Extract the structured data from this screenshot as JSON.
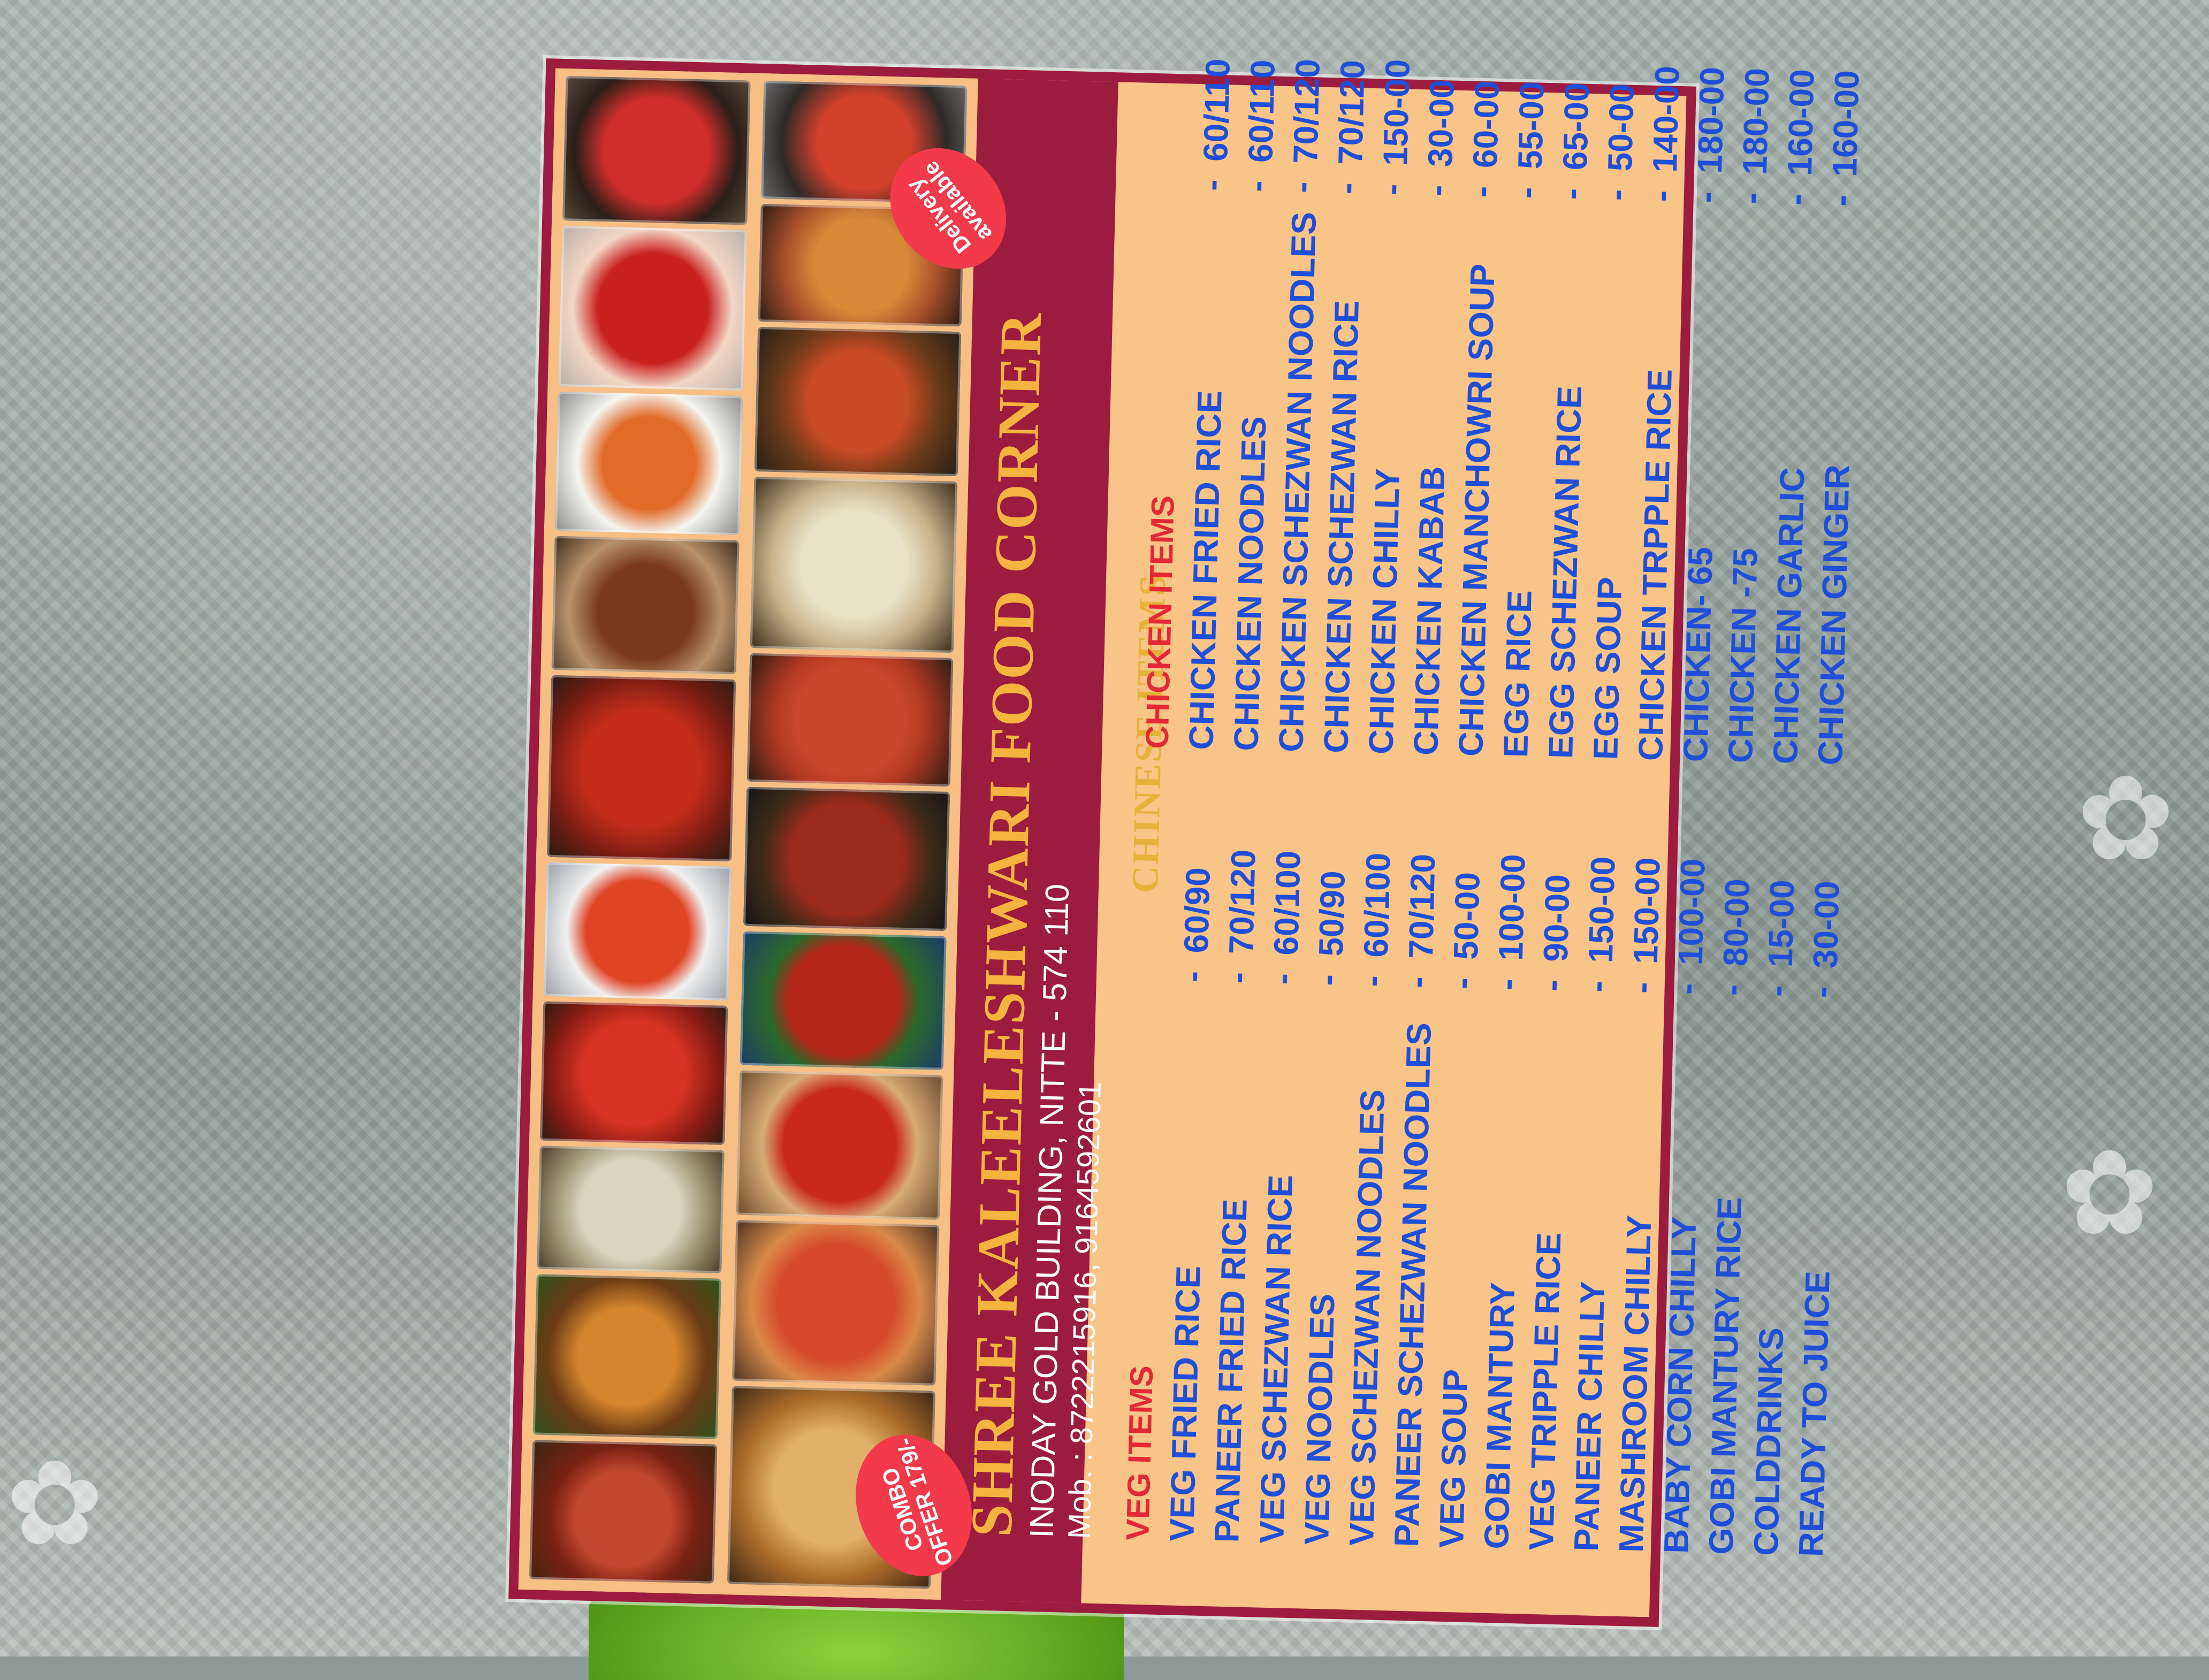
{
  "header": {
    "shop_name": "SHREE KALEELESHWARI FOOD CORNER",
    "address": "INODAY GOLD BUILDING, NITTE - 574 110",
    "mobile": "Mob. : 8722215916, 9164592601",
    "subtitle": "CHINESE ITEMS"
  },
  "badges": {
    "combo": "COMBO OFFER 179/-",
    "delivery": "Delivery available"
  },
  "veg_section": {
    "title": "VEG ITEMS",
    "items": [
      {
        "name": "VEG FRIED RICE",
        "price": "60/90"
      },
      {
        "name": "PANEER FRIED RICE",
        "price": "70/120"
      },
      {
        "name": "VEG SCHEZWAN RICE",
        "price": "60/100"
      },
      {
        "name": "VEG NOODLES",
        "price": "50/90"
      },
      {
        "name": "VEG SCHEZWAN NOODLES",
        "price": "60/100"
      },
      {
        "name": "PANEER SCHEZWAN NOODLES",
        "price": "70/120"
      },
      {
        "name": "VEG SOUP",
        "price": "50-00"
      },
      {
        "name": "GOBI MANTURY",
        "price": "100-00"
      },
      {
        "name": "VEG TRIPPLE RICE",
        "price": "90-00"
      },
      {
        "name": "PANEER CHILLY",
        "price": "150-00"
      },
      {
        "name": "MASHROOM CHILLY",
        "price": "150-00"
      },
      {
        "name": "BABY CORN CHILLY",
        "price": "100-00"
      },
      {
        "name": "GOBI MANTURY RICE",
        "price": "80-00"
      },
      {
        "name": "COLDDRINKS",
        "price": "15-00"
      },
      {
        "name": "READY TO JUICE",
        "price": "30-00"
      }
    ]
  },
  "chicken_section": {
    "title": "CHICKEN ITEMS",
    "items": [
      {
        "name": "CHICKEN FRIED RICE",
        "price": "60/110"
      },
      {
        "name": "CHICKEN NOODLES",
        "price": "60/110"
      },
      {
        "name": "CHICKEN SCHEZWAN NOODLES",
        "price": "70/120"
      },
      {
        "name": "CHICKEN SCHEZWAN RICE",
        "price": "70/120"
      },
      {
        "name": "CHICKEN CHILLY",
        "price": "150-00"
      },
      {
        "name": "CHICKEN KABAB",
        "price": "30-00"
      },
      {
        "name": "CHICKEN MANCHOWRI  SOUP",
        "price": "60-00"
      },
      {
        "name": "EGG RICE",
        "price": "55-00"
      },
      {
        "name": "EGG SCHEZWAN  RICE",
        "price": "65-00"
      },
      {
        "name": "EGG SOUP",
        "price": "50-00"
      },
      {
        "name": "CHICKEN TRPPLE  RICE",
        "price": "140-00"
      },
      {
        "name": "CHICKEN- 65",
        "price": "180-00"
      },
      {
        "name": "CHICKEN -75",
        "price": "180-00"
      },
      {
        "name": "CHICKEN GARLIC",
        "price": "160-00"
      },
      {
        "name": "CHICKEN GINGER",
        "price": "160-00"
      }
    ]
  },
  "separator": "-",
  "colors": {
    "card_background": "#f9c488",
    "band": "#9c1c3f",
    "item_text": "#1f4fd8",
    "section_title": "#e32935",
    "shop_name": "#f4b43f"
  }
}
